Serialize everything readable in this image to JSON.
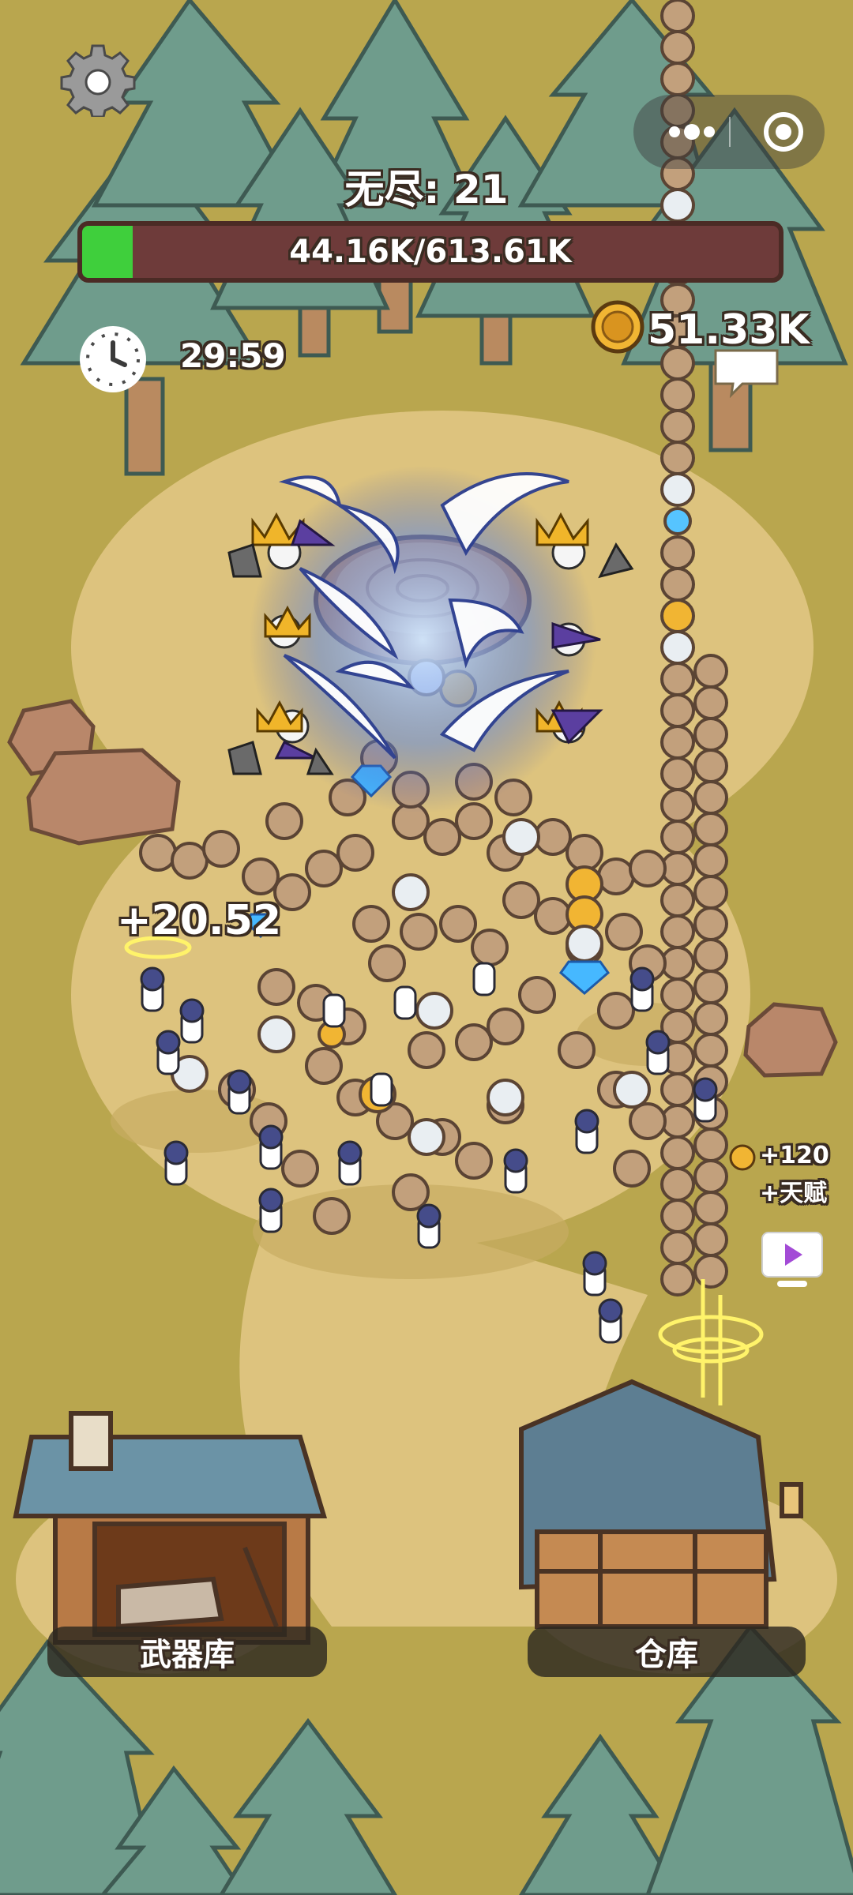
{
  "hud": {
    "wave_title": "无尽: 21",
    "boss_hp_text": "44.16K/613.61K",
    "boss_hp_fraction": 0.072,
    "timer": "29:59",
    "coins": "51.33K"
  },
  "popups": {
    "damage": "+20.52",
    "talent_amount": "+120",
    "talent_label": "+天赋"
  },
  "buildings": {
    "armory_label": "武器库",
    "warehouse_label": "仓库"
  },
  "icons": {
    "settings": "gear-icon",
    "timer": "clock-icon",
    "coin": "coin-icon",
    "chat": "chat-bubble-icon",
    "video": "play-video-icon",
    "capsule_more": "more-dots-icon",
    "capsule_close": "target-close-icon"
  },
  "colors": {
    "hp_fill": "#3fcf3c",
    "hp_bg": "#6e3b3a",
    "ground": "#b9a64e",
    "path": "#ddc37e"
  }
}
